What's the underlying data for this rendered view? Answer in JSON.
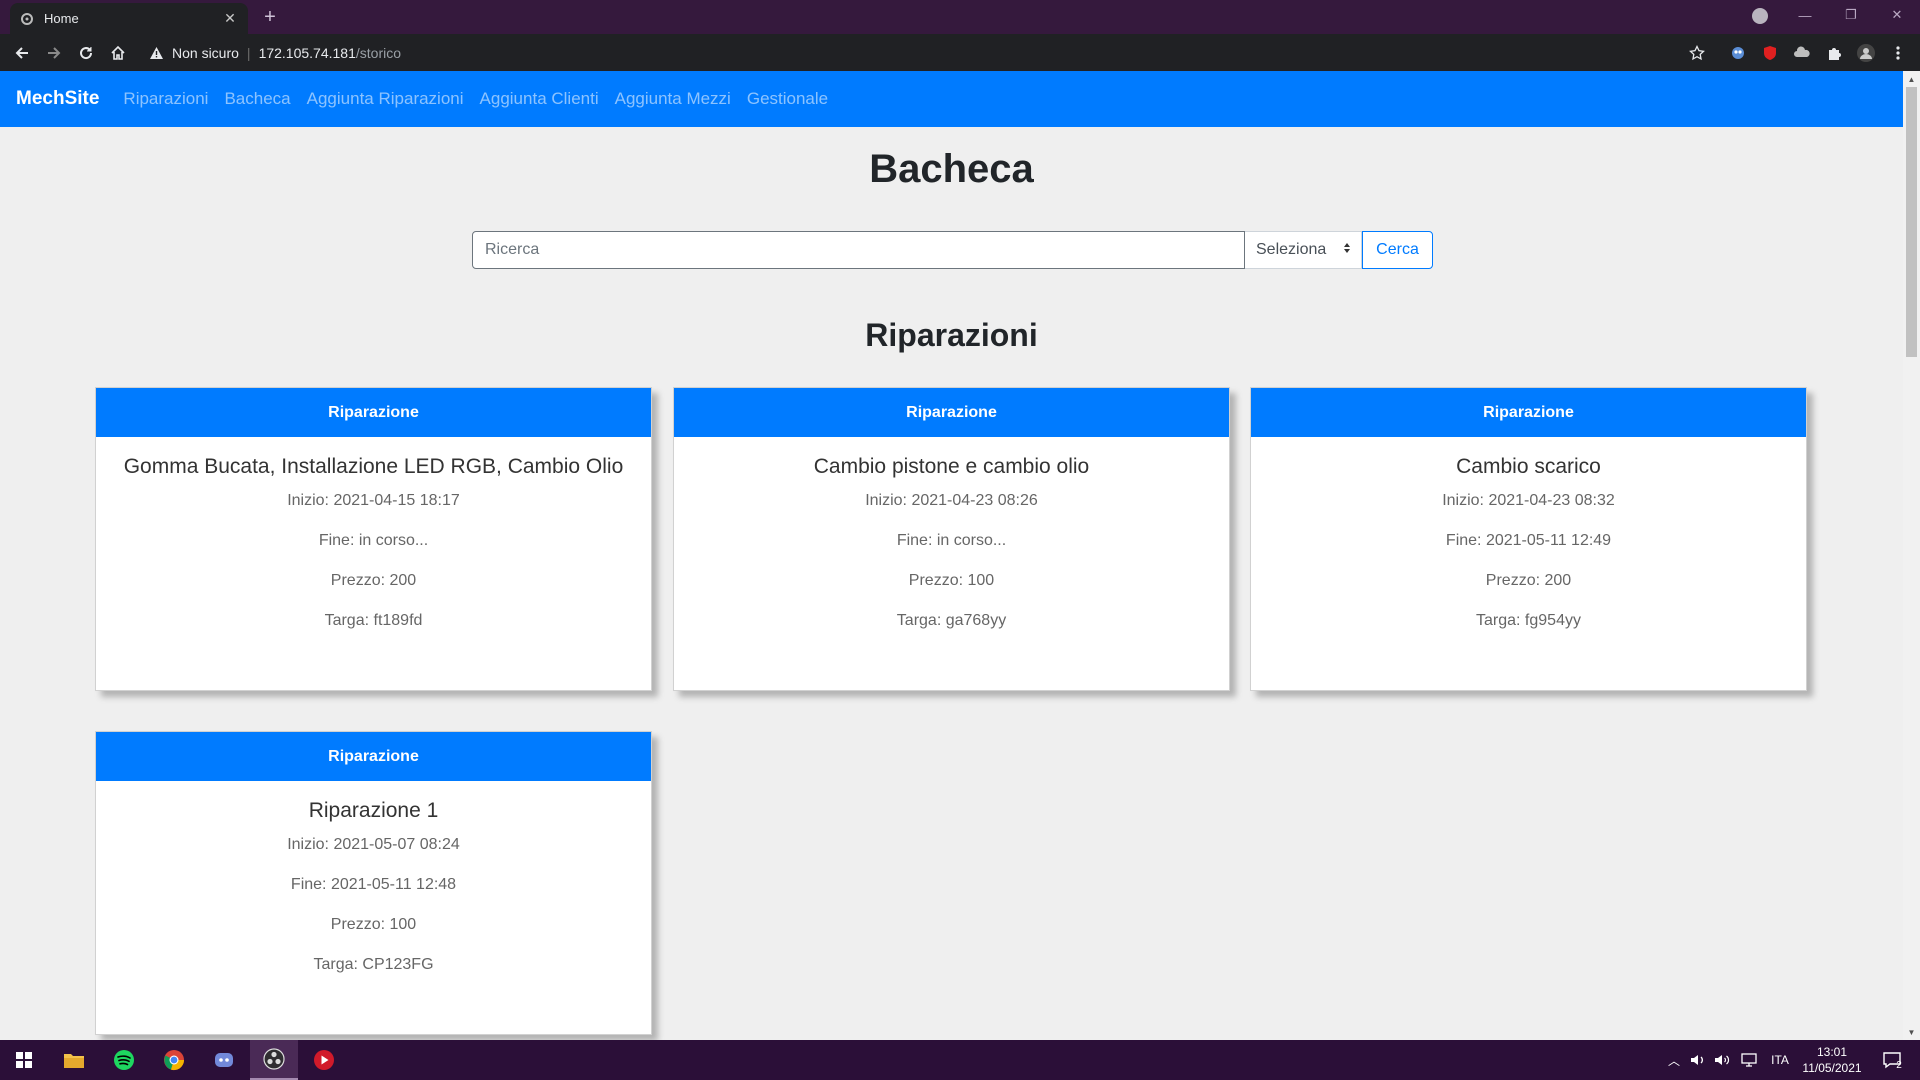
{
  "browser": {
    "tab_title": "Home",
    "new_tab": "+",
    "security_label": "Non sicuro",
    "url_host": "172.105.74.181",
    "url_path": "/storico"
  },
  "site": {
    "brand": "MechSite",
    "nav": [
      "Riparazioni",
      "Bacheca",
      "Aggiunta Riparazioni",
      "Aggiunta Clienti",
      "Aggiunta Mezzi",
      "Gestionale"
    ]
  },
  "page": {
    "title": "Bacheca",
    "search_placeholder": "Ricerca",
    "select_value": "Seleziona",
    "search_button": "Cerca",
    "section_title": "Riparazioni"
  },
  "cards": [
    {
      "header": "Riparazione",
      "title": "Gomma Bucata, Installazione LED RGB, Cambio Olio",
      "inizio": "Inizio: 2021-04-15 18:17",
      "fine": "Fine: in corso...",
      "prezzo": "Prezzo: 200",
      "targa": "Targa: ft189fd"
    },
    {
      "header": "Riparazione",
      "title": "Cambio pistone e cambio olio",
      "inizio": "Inizio: 2021-04-23 08:26",
      "fine": "Fine: in corso...",
      "prezzo": "Prezzo: 100",
      "targa": "Targa: ga768yy"
    },
    {
      "header": "Riparazione",
      "title": "Cambio scarico",
      "inizio": "Inizio: 2021-04-23 08:32",
      "fine": "Fine: 2021-05-11 12:49",
      "prezzo": "Prezzo: 200",
      "targa": "Targa: fg954yy"
    },
    {
      "header": "Riparazione",
      "title": "Riparazione 1",
      "inizio": "Inizio: 2021-05-07 08:24",
      "fine": "Fine: 2021-05-11 12:48",
      "prezzo": "Prezzo: 100",
      "targa": "Targa: CP123FG"
    }
  ],
  "taskbar": {
    "language": "ITA",
    "time": "13:01",
    "date": "11/05/2021",
    "notifications": "2"
  },
  "colors": {
    "primary": "#007bff",
    "tabstrip": "#35193d",
    "taskbar": "#2b0f38"
  }
}
